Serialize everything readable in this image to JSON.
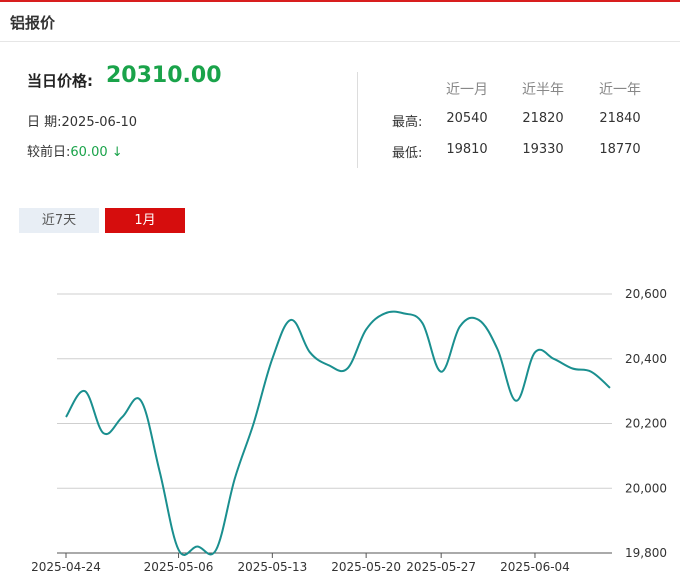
{
  "header": {
    "title": "铝报价"
  },
  "summary": {
    "price_label": "当日价格:",
    "price_value": "20310.00",
    "date_label": "日 期:",
    "date_value": "2025-06-10",
    "change_label": "较前日:",
    "change_value": "60.00",
    "change_arrow": "↓"
  },
  "stats": {
    "headers": [
      "近一月",
      "近半年",
      "近一年"
    ],
    "rows": [
      {
        "label": "最高:",
        "values": [
          "20540",
          "21820",
          "21840"
        ]
      },
      {
        "label": "最低:",
        "values": [
          "19810",
          "19330",
          "18770"
        ]
      }
    ]
  },
  "tabs": [
    {
      "label": "近7天",
      "active": false
    },
    {
      "label": "1月",
      "active": true
    }
  ],
  "colors": {
    "line": "#1a8f8f",
    "accent": "#d60d0d",
    "up_down": "#1aa34a"
  },
  "chart_data": {
    "type": "line",
    "ylim": [
      19800,
      20600
    ],
    "yticks": [
      19800,
      20000,
      20200,
      20400,
      20600
    ],
    "ytick_labels": [
      "19,800",
      "20,000",
      "20,200",
      "20,400",
      "20,600"
    ],
    "x_tick_labels": [
      "2025-04-24",
      "2025-05-06",
      "2025-05-13",
      "2025-05-20",
      "2025-05-27",
      "2025-06-04"
    ],
    "x_tick_index": [
      0,
      6,
      11,
      16,
      20,
      25
    ],
    "grid": true,
    "series": [
      {
        "values": [
          20220,
          20300,
          20170,
          20220,
          20270,
          20050,
          19810,
          19820,
          19810,
          20030,
          20200,
          20400,
          20520,
          20420,
          20380,
          20370,
          20490,
          20540,
          20540,
          20510,
          20360,
          20500,
          20520,
          20430,
          20270,
          20420,
          20400,
          20370,
          20360,
          20310
        ]
      }
    ]
  }
}
